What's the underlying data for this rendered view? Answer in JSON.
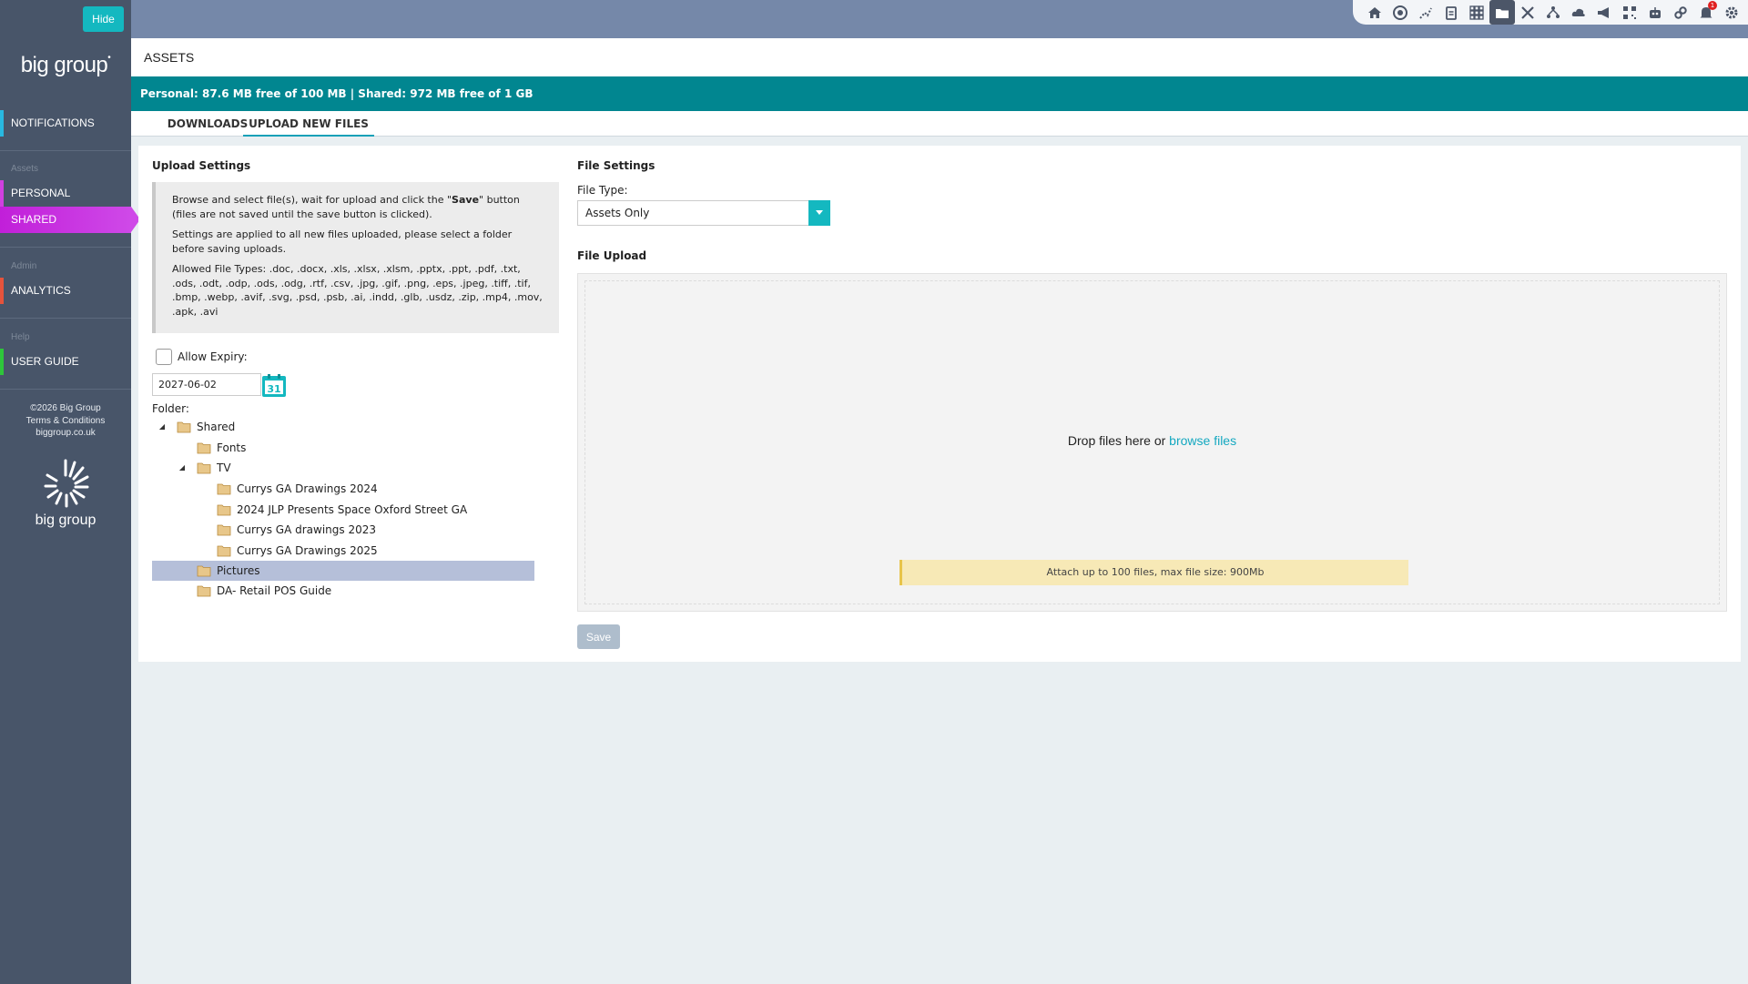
{
  "sidebar": {
    "hide_label": "Hide",
    "logo": "big group",
    "logo_mark": "•",
    "notifications": "NOTIFICATIONS",
    "section_assets": "Assets",
    "personal": "PERSONAL",
    "shared": "SHARED",
    "section_admin": "Admin",
    "analytics": "ANALYTICS",
    "section_help": "Help",
    "user_guide": "USER GUIDE",
    "footer_copyright": "©2026 Big Group",
    "footer_terms": "Terms & Conditions",
    "footer_site": "biggroup.co.uk",
    "footer_logo_text": "big group"
  },
  "toolbar": {
    "icons": [
      "home-icon",
      "aperture-icon",
      "route-icon",
      "clipboard-icon",
      "grid-icon",
      "folder-icon",
      "tools-icon",
      "network-icon",
      "cloud-upload-icon",
      "megaphone-icon",
      "qr-icon",
      "robot-icon",
      "link-icon",
      "bell-icon",
      "gear-icon"
    ],
    "notification_count": "1"
  },
  "page": {
    "title": "ASSETS",
    "storage": "Personal: 87.6 MB free of 100 MB | Shared: 972 MB free of 1 GB",
    "tabs": [
      "DOWNLOADS",
      "UPLOAD NEW FILES"
    ]
  },
  "upload_settings": {
    "title": "Upload Settings",
    "info_1a": "Browse and select file(s), wait for upload and click the \"",
    "info_1b": "Save",
    "info_1c": "\" button (files are not saved until the save button is clicked).",
    "info_2": "Settings are applied to all new files uploaded, please select a folder before saving uploads.",
    "info_3": "Allowed File Types: .doc, .docx, .xls, .xlsx, .xlsm, .pptx, .ppt, .pdf, .txt, .ods, .odt, .odp, .ods, .odg, .rtf, .csv, .jpg, .gif, .png, .eps, .jpeg, .tiff, .tif, .bmp, .webp, .avif, .svg, .psd, .psb, .ai, .indd, .glb, .usdz, .zip, .mp4, .mov, .apk, .avi",
    "allow_expiry": "Allow Expiry:",
    "expiry_date": "2027-06-02",
    "calendar_day": "31",
    "folder_label": "Folder:"
  },
  "folders": {
    "shared": "Shared",
    "fonts": "Fonts",
    "tv": "TV",
    "currys_2024": "Currys GA Drawings 2024",
    "jlp": "2024 JLP Presents Space Oxford Street GA",
    "currys_2023": "Currys GA drawings 2023",
    "currys_2025": "Currys GA Drawings 2025",
    "pictures": "Pictures",
    "da_retail": "DA- Retail POS Guide"
  },
  "file_settings": {
    "title": "File Settings",
    "file_type_label": "File Type:",
    "file_type_value": "Assets Only",
    "upload_title": "File Upload",
    "drop_text": "Drop files here or ",
    "browse_link": "browse files",
    "limit_note": "Attach up to 100 files, max file size: 900Mb",
    "save_label": "Save"
  },
  "colors": {
    "sidebar": "#485569",
    "teal": "#018690",
    "accent": "#14b8c0",
    "active_nav": "#c11fd9"
  }
}
